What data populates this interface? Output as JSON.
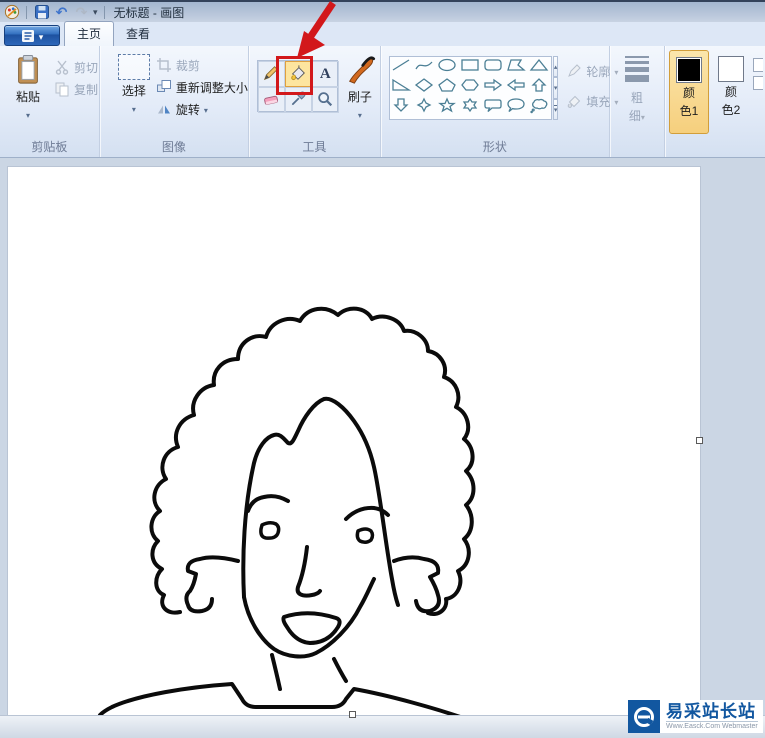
{
  "window": {
    "title": "无标题 - 画图"
  },
  "titlebar": {
    "icons": [
      "paint-app-icon",
      "save-icon",
      "undo-icon",
      "redo-icon",
      "qat-dropdown-icon"
    ]
  },
  "tabs": [
    {
      "label": "主页",
      "active": true
    },
    {
      "label": "查看",
      "active": false
    }
  ],
  "ribbon": {
    "clipboard": {
      "group_label": "剪贴板",
      "paste": "粘贴",
      "cut": "剪切",
      "copy": "复制"
    },
    "image": {
      "group_label": "图像",
      "select": "选择",
      "crop": "裁剪",
      "resize": "重新调整大小",
      "rotate": "旋转"
    },
    "tools": {
      "group_label": "工具",
      "brush": "刷子",
      "items": [
        "pencil",
        "fill",
        "text",
        "eraser",
        "color-picker",
        "magnifier"
      ],
      "active": "fill"
    },
    "shapes": {
      "group_label": "形状",
      "outline": "轮廓",
      "fill": "填充",
      "items": [
        "line",
        "curve",
        "ellipse",
        "rectangle",
        "rounded-rectangle",
        "polygon",
        "triangle",
        "right-triangle",
        "diamond",
        "pentagon",
        "hexagon",
        "arrow-right",
        "arrow-left",
        "arrow-up",
        "arrow-down",
        "star-4",
        "star-5",
        "star-6",
        "callout-rounded",
        "callout-oval",
        "callout-cloud"
      ]
    },
    "size": {
      "line1": "粗",
      "line2": "细"
    },
    "colors": {
      "color1": {
        "line1": "颜",
        "line2": "色1",
        "value": "#000000",
        "selected": true
      },
      "color2": {
        "line1": "颜",
        "line2": "色2",
        "value": "#ffffff",
        "selected": false
      }
    }
  },
  "annotation": {
    "type": "red-arrow-and-box",
    "color": "#d2181b",
    "target_tool": "fill"
  },
  "watermark": {
    "title": "易采站长站",
    "subtitle": "Www.Easck.Com Webmaster"
  }
}
